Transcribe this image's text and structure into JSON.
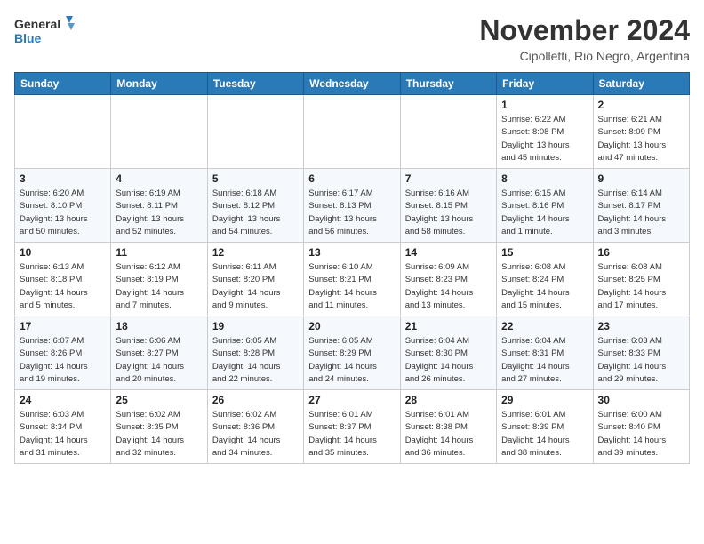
{
  "header": {
    "logo_line1": "General",
    "logo_line2": "Blue",
    "month_title": "November 2024",
    "location": "Cipolletti, Rio Negro, Argentina"
  },
  "days_of_week": [
    "Sunday",
    "Monday",
    "Tuesday",
    "Wednesday",
    "Thursday",
    "Friday",
    "Saturday"
  ],
  "weeks": [
    [
      {
        "day": "",
        "info": ""
      },
      {
        "day": "",
        "info": ""
      },
      {
        "day": "",
        "info": ""
      },
      {
        "day": "",
        "info": ""
      },
      {
        "day": "",
        "info": ""
      },
      {
        "day": "1",
        "info": "Sunrise: 6:22 AM\nSunset: 8:08 PM\nDaylight: 13 hours\nand 45 minutes."
      },
      {
        "day": "2",
        "info": "Sunrise: 6:21 AM\nSunset: 8:09 PM\nDaylight: 13 hours\nand 47 minutes."
      }
    ],
    [
      {
        "day": "3",
        "info": "Sunrise: 6:20 AM\nSunset: 8:10 PM\nDaylight: 13 hours\nand 50 minutes."
      },
      {
        "day": "4",
        "info": "Sunrise: 6:19 AM\nSunset: 8:11 PM\nDaylight: 13 hours\nand 52 minutes."
      },
      {
        "day": "5",
        "info": "Sunrise: 6:18 AM\nSunset: 8:12 PM\nDaylight: 13 hours\nand 54 minutes."
      },
      {
        "day": "6",
        "info": "Sunrise: 6:17 AM\nSunset: 8:13 PM\nDaylight: 13 hours\nand 56 minutes."
      },
      {
        "day": "7",
        "info": "Sunrise: 6:16 AM\nSunset: 8:15 PM\nDaylight: 13 hours\nand 58 minutes."
      },
      {
        "day": "8",
        "info": "Sunrise: 6:15 AM\nSunset: 8:16 PM\nDaylight: 14 hours\nand 1 minute."
      },
      {
        "day": "9",
        "info": "Sunrise: 6:14 AM\nSunset: 8:17 PM\nDaylight: 14 hours\nand 3 minutes."
      }
    ],
    [
      {
        "day": "10",
        "info": "Sunrise: 6:13 AM\nSunset: 8:18 PM\nDaylight: 14 hours\nand 5 minutes."
      },
      {
        "day": "11",
        "info": "Sunrise: 6:12 AM\nSunset: 8:19 PM\nDaylight: 14 hours\nand 7 minutes."
      },
      {
        "day": "12",
        "info": "Sunrise: 6:11 AM\nSunset: 8:20 PM\nDaylight: 14 hours\nand 9 minutes."
      },
      {
        "day": "13",
        "info": "Sunrise: 6:10 AM\nSunset: 8:21 PM\nDaylight: 14 hours\nand 11 minutes."
      },
      {
        "day": "14",
        "info": "Sunrise: 6:09 AM\nSunset: 8:23 PM\nDaylight: 14 hours\nand 13 minutes."
      },
      {
        "day": "15",
        "info": "Sunrise: 6:08 AM\nSunset: 8:24 PM\nDaylight: 14 hours\nand 15 minutes."
      },
      {
        "day": "16",
        "info": "Sunrise: 6:08 AM\nSunset: 8:25 PM\nDaylight: 14 hours\nand 17 minutes."
      }
    ],
    [
      {
        "day": "17",
        "info": "Sunrise: 6:07 AM\nSunset: 8:26 PM\nDaylight: 14 hours\nand 19 minutes."
      },
      {
        "day": "18",
        "info": "Sunrise: 6:06 AM\nSunset: 8:27 PM\nDaylight: 14 hours\nand 20 minutes."
      },
      {
        "day": "19",
        "info": "Sunrise: 6:05 AM\nSunset: 8:28 PM\nDaylight: 14 hours\nand 22 minutes."
      },
      {
        "day": "20",
        "info": "Sunrise: 6:05 AM\nSunset: 8:29 PM\nDaylight: 14 hours\nand 24 minutes."
      },
      {
        "day": "21",
        "info": "Sunrise: 6:04 AM\nSunset: 8:30 PM\nDaylight: 14 hours\nand 26 minutes."
      },
      {
        "day": "22",
        "info": "Sunrise: 6:04 AM\nSunset: 8:31 PM\nDaylight: 14 hours\nand 27 minutes."
      },
      {
        "day": "23",
        "info": "Sunrise: 6:03 AM\nSunset: 8:33 PM\nDaylight: 14 hours\nand 29 minutes."
      }
    ],
    [
      {
        "day": "24",
        "info": "Sunrise: 6:03 AM\nSunset: 8:34 PM\nDaylight: 14 hours\nand 31 minutes."
      },
      {
        "day": "25",
        "info": "Sunrise: 6:02 AM\nSunset: 8:35 PM\nDaylight: 14 hours\nand 32 minutes."
      },
      {
        "day": "26",
        "info": "Sunrise: 6:02 AM\nSunset: 8:36 PM\nDaylight: 14 hours\nand 34 minutes."
      },
      {
        "day": "27",
        "info": "Sunrise: 6:01 AM\nSunset: 8:37 PM\nDaylight: 14 hours\nand 35 minutes."
      },
      {
        "day": "28",
        "info": "Sunrise: 6:01 AM\nSunset: 8:38 PM\nDaylight: 14 hours\nand 36 minutes."
      },
      {
        "day": "29",
        "info": "Sunrise: 6:01 AM\nSunset: 8:39 PM\nDaylight: 14 hours\nand 38 minutes."
      },
      {
        "day": "30",
        "info": "Sunrise: 6:00 AM\nSunset: 8:40 PM\nDaylight: 14 hours\nand 39 minutes."
      }
    ]
  ]
}
